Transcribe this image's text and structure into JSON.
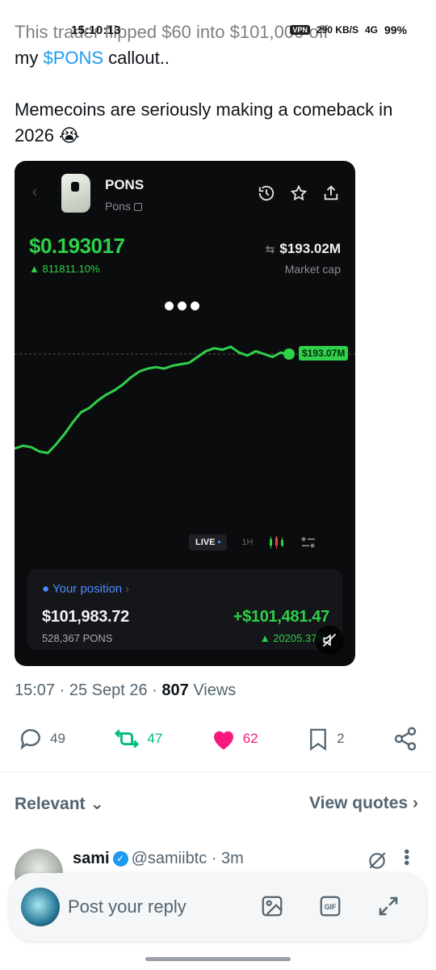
{
  "status_bar": {
    "time": "15:10:13",
    "vpn": "VPN",
    "net_speed": "290 KB/S",
    "signal": "4G",
    "battery": "99%"
  },
  "tweet": {
    "line1": "This trader flipped $60 into $101,000 off",
    "line2_prefix": "my ",
    "cashtag": "$PONS",
    "line2_suffix": " callout..",
    "para2": "Memecoins are seriously making a comeback in 2026 😭"
  },
  "card": {
    "token_name": "PONS",
    "token_sub": "Pons",
    "price": "$0.193017",
    "change": "▲ 811811.10%",
    "market_cap": "$193.02M",
    "market_cap_label": "Market cap",
    "last_value_tag": "$193.07M",
    "controls": {
      "live": "LIVE",
      "h1": "1H"
    },
    "position": {
      "title": "Your position",
      "value": "$101,983.72",
      "qty": "528,367 PONS",
      "pnl": "+$101,481.47",
      "pnl_pct": "▲ 20205.37%"
    },
    "colors": {
      "green": "#2fd04a",
      "blue": "#4a8cff",
      "bg": "#0b0c0e"
    }
  },
  "meta": {
    "time": "15:07",
    "date": "25 Sept 26",
    "views_count": "807",
    "views_label": "Views"
  },
  "actions": {
    "replies": "49",
    "reposts": "47",
    "likes": "62",
    "bookmarks": "2"
  },
  "filters": {
    "relevant": "Relevant",
    "view_quotes": "View quotes"
  },
  "reply": {
    "name": "sami",
    "handle": "@samiibtc",
    "time": "3m"
  },
  "composer": {
    "placeholder": "Post your reply",
    "gif": "GIF"
  },
  "chart_data": {
    "type": "line",
    "series": [
      {
        "values": [
          0.3,
          0.32,
          0.31,
          0.28,
          0.27,
          0.33,
          0.4,
          0.48,
          0.55,
          0.58,
          0.63,
          0.67,
          0.7,
          0.74,
          0.79,
          0.83,
          0.85,
          0.86,
          0.85,
          0.87,
          0.88,
          0.89,
          0.93,
          0.97,
          0.99,
          0.98,
          1.0,
          0.96,
          0.94,
          0.97,
          0.95,
          0.93,
          0.96,
          0.95
        ]
      }
    ],
    "last_value": "$193.07M"
  }
}
